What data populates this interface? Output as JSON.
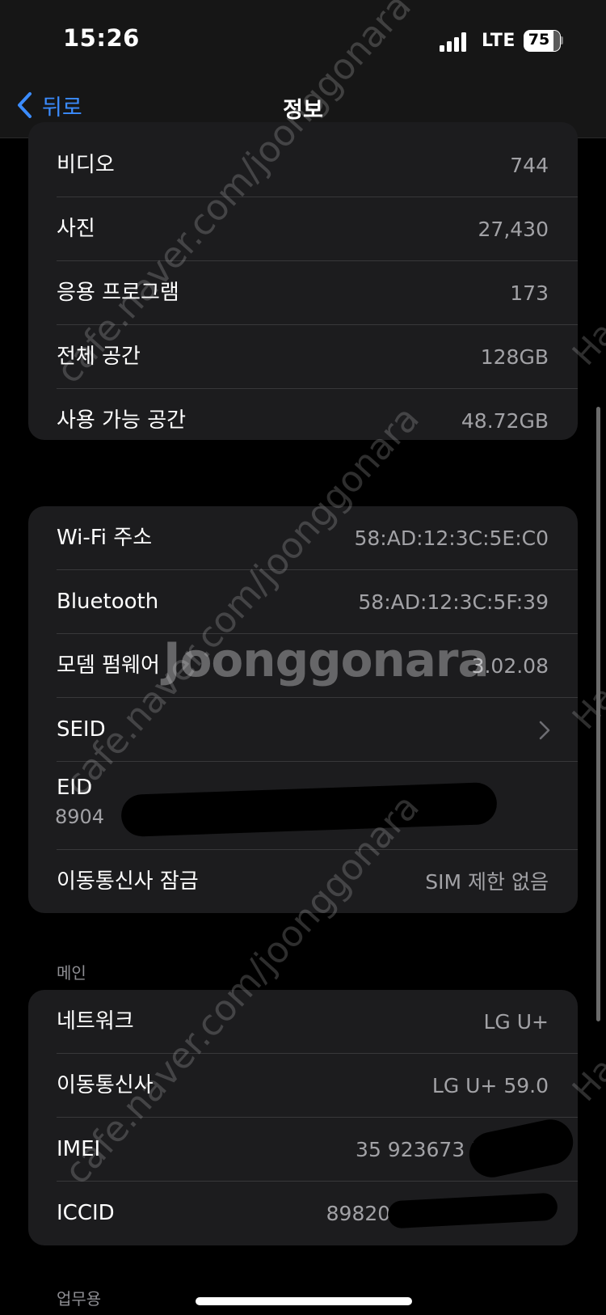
{
  "status": {
    "time": "15:26",
    "network": "LTE",
    "battery": "75"
  },
  "nav": {
    "back_label": "뒤로",
    "title": "정보"
  },
  "group1": [
    {
      "label": "비디오",
      "value": "744"
    },
    {
      "label": "사진",
      "value": "27,430"
    },
    {
      "label": "응용 프로그램",
      "value": "173"
    },
    {
      "label": "전체 공간",
      "value": "128GB"
    },
    {
      "label": "사용 가능 공간",
      "value": "48.72GB"
    }
  ],
  "group2": {
    "wifi": {
      "label": "Wi-Fi 주소",
      "value": "58:AD:12:3C:5E:C0"
    },
    "bluetooth": {
      "label": "Bluetooth",
      "value": "58:AD:12:3C:5F:39"
    },
    "modem": {
      "label": "모뎀 펌웨어",
      "value": "3.02.08"
    },
    "seid": {
      "label": "SEID"
    },
    "eid": {
      "label": "EID",
      "value": "8904"
    },
    "carrier_lock": {
      "label": "이동통신사 잠금",
      "value": "SIM 제한 없음"
    }
  },
  "section_main": "메인",
  "group3": [
    {
      "label": "네트워크",
      "value": "LG U+"
    },
    {
      "label": "이동통신사",
      "value": "LG U+ 59.0"
    },
    {
      "label": "IMEI",
      "value": "35 923673 79"
    },
    {
      "label": "ICCID",
      "value": "8982066"
    }
  ],
  "section_work": "업무용",
  "watermark": {
    "logo": "Joonggonara",
    "url": "cafe.naver.com/joonggonara",
    "side": "Ha"
  }
}
